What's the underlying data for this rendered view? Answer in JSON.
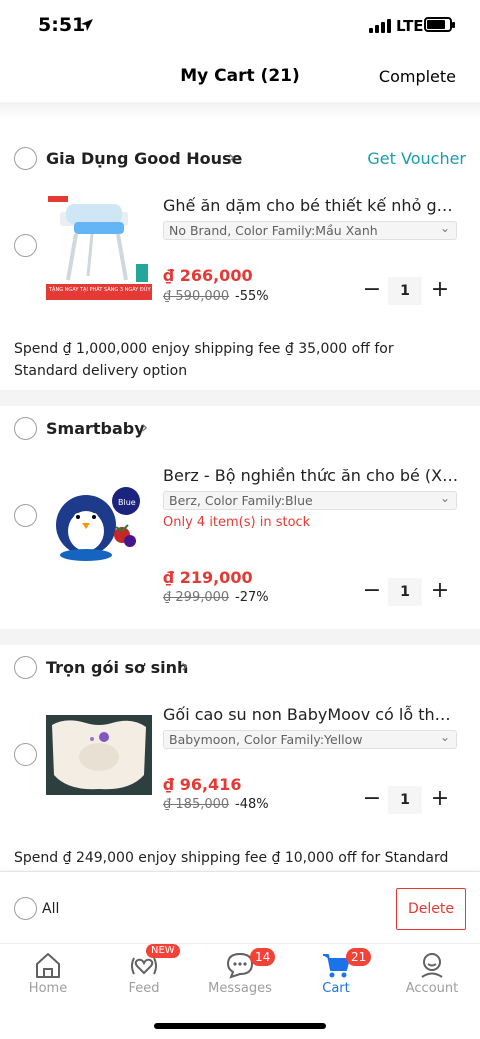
{
  "status": {
    "time": "5:51",
    "network": "LTE"
  },
  "header": {
    "title": "My Cart (21)",
    "complete_label": "Complete"
  },
  "shops": [
    {
      "name": "Gia Dụng Good House",
      "voucher_label": "Get Voucher",
      "item": {
        "title": "Ghế ăn dặm cho bé thiết kế nhỏ gọn...",
        "variant": "No Brand, Color Family:Mầu Xanh",
        "price": "₫ 266,000",
        "old_price": "₫ 590,000",
        "discount": "-55%",
        "quantity": "1",
        "image_banner_text": "TẶNG NGAY TẠI PHÁT SÀNG 3 NGÀY ĐỦY NHẤT"
      },
      "promo": "Spend ₫ 1,000,000 enjoy shipping fee ₫ 35,000 off for Standard delivery option"
    },
    {
      "name": "Smartbaby",
      "item": {
        "title": "Berz - Bộ nghiền thức ăn cho bé (Xan...",
        "variant": "Berz, Color Family:Blue",
        "stock": "Only 4 item(s) in stock",
        "price": "₫ 219,000",
        "old_price": "₫ 299,000",
        "discount": "-27%",
        "quantity": "1",
        "image_tag": "Blue"
      }
    },
    {
      "name": "Trọn gói sơ sinh",
      "item": {
        "title": "Gối cao su non BabyMoov có lỗ thôn...",
        "variant": "Babymoon, Color Family:Yellow",
        "price": "₫ 96,416",
        "old_price": "₫ 185,000",
        "discount": "-48%",
        "quantity": "1"
      },
      "promo": "Spend ₫ 249,000 enjoy shipping fee ₫ 10,000 off for Standard"
    }
  ],
  "bottom": {
    "all_label": "All",
    "delete_label": "Delete"
  },
  "tabs": [
    {
      "label": "Home",
      "icon": "home-icon"
    },
    {
      "label": "Feed",
      "icon": "feed-icon",
      "badge": "NEW"
    },
    {
      "label": "Messages",
      "icon": "messages-icon",
      "badge": "14"
    },
    {
      "label": "Cart",
      "icon": "cart-icon",
      "badge": "21",
      "active": true
    },
    {
      "label": "Account",
      "icon": "account-icon"
    }
  ],
  "colors": {
    "price_red": "#e53935",
    "accent_blue": "#1a73e8",
    "voucher_teal": "#1a9cb0",
    "badge_red": "#f44336"
  }
}
